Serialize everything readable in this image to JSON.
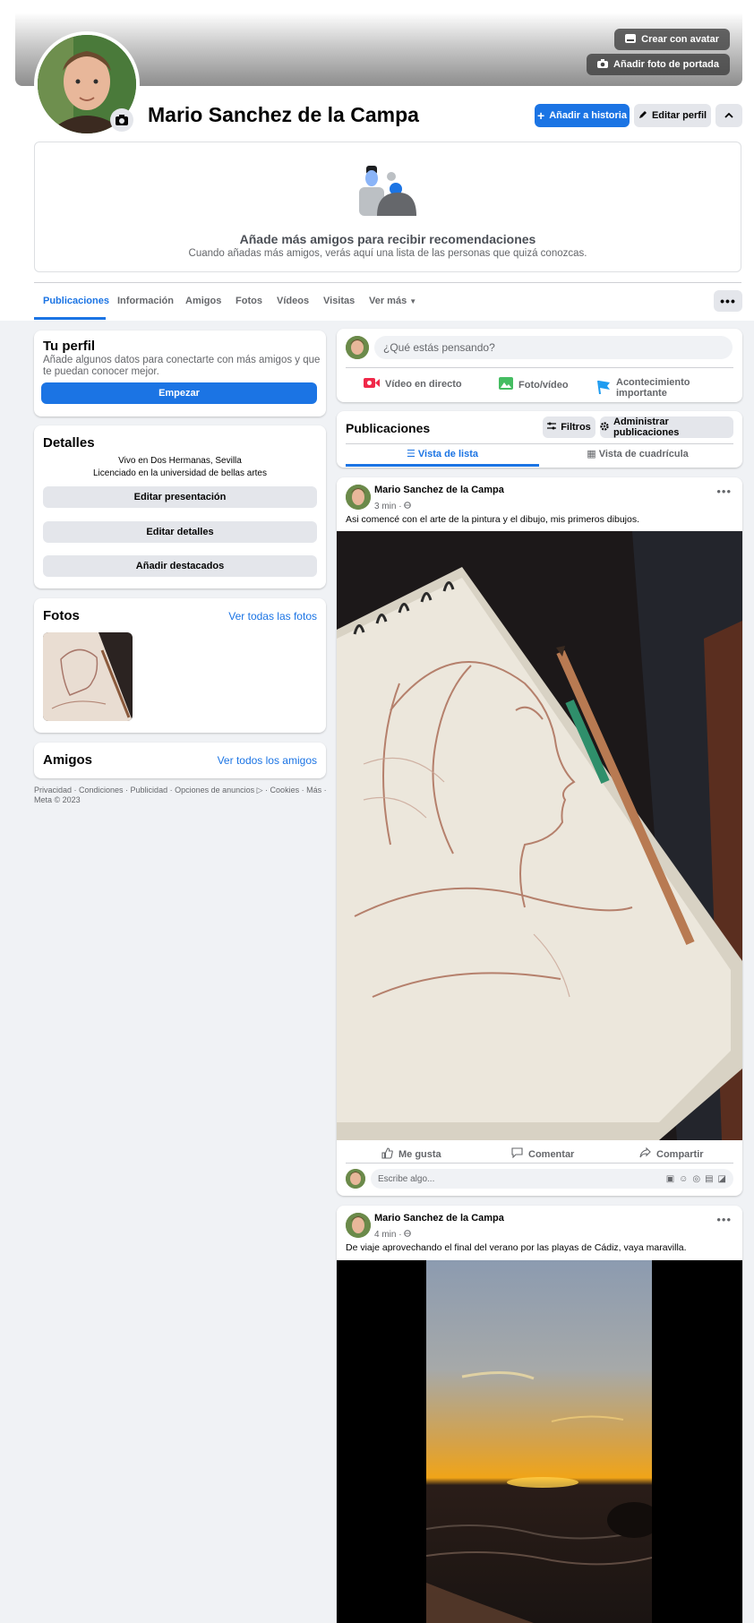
{
  "cover": {
    "avatar_button": "Crear con avatar",
    "cover_photo_button": "Añadir foto de portada"
  },
  "profile": {
    "name": "Mario Sanchez de la Campa",
    "add_story": "Añadir a historia",
    "edit_profile": "Editar perfil"
  },
  "suggestions": {
    "title": "Añade más amigos para recibir recomendaciones",
    "subtitle": "Cuando añadas más amigos, verás aquí una lista de las personas que quizá conozcas."
  },
  "tabs": [
    "Publicaciones",
    "Información",
    "Amigos",
    "Fotos",
    "Vídeos",
    "Visitas",
    "Ver más"
  ],
  "sidebar": {
    "profile_title": "Tu perfil",
    "profile_text": "Añade algunos datos para conectarte con más amigos y que te puedan conocer mejor.",
    "start_button": "Empezar",
    "details_title": "Detalles",
    "details_lines": [
      "Vivo en Dos Hermanas, Sevilla",
      "Licenciado en la universidad de bellas artes"
    ],
    "edit_presentation": "Editar presentación",
    "edit_details": "Editar detalles",
    "add_highlights": "Añadir destacados",
    "photos_title": "Fotos",
    "photos_link": "Ver todas las fotos",
    "friends_title": "Amigos",
    "friends_link": "Ver todos los amigos",
    "footer": "Privacidad · Condiciones · Publicidad · Opciones de anuncios ▷ · Cookies · Más · Meta © 2023"
  },
  "composer": {
    "placeholder": "¿Qué estás pensando?",
    "live": "Vídeo en directo",
    "photo": "Foto/vídeo",
    "event": "Acontecimiento importante"
  },
  "posts_header": {
    "title": "Publicaciones",
    "filters": "Filtros",
    "manage": "Administrar publicaciones",
    "list_view": "Vista de lista",
    "grid_view": "Vista de cuadrícula"
  },
  "posts": [
    {
      "author": "Mario Sanchez de la Campa",
      "time": "3 min · ",
      "text": "Asi comencé con el arte de la pintura y el dibujo, mis primeros dibujos.",
      "like": "Me gusta",
      "comment": "Comentar",
      "share": "Compartir",
      "comment_placeholder": "Escribe algo..."
    },
    {
      "author": "Mario Sanchez de la Campa",
      "time": "4 min · ",
      "text": "De viaje aprovechando el final del verano por las playas de Cádiz, vaya maravilla."
    }
  ],
  "colors": {
    "accent": "#1b74e4",
    "background": "#f0f2f5",
    "live_red": "#f02849",
    "photo_green": "#45bd62",
    "event_blue": "#1d9bf0"
  }
}
